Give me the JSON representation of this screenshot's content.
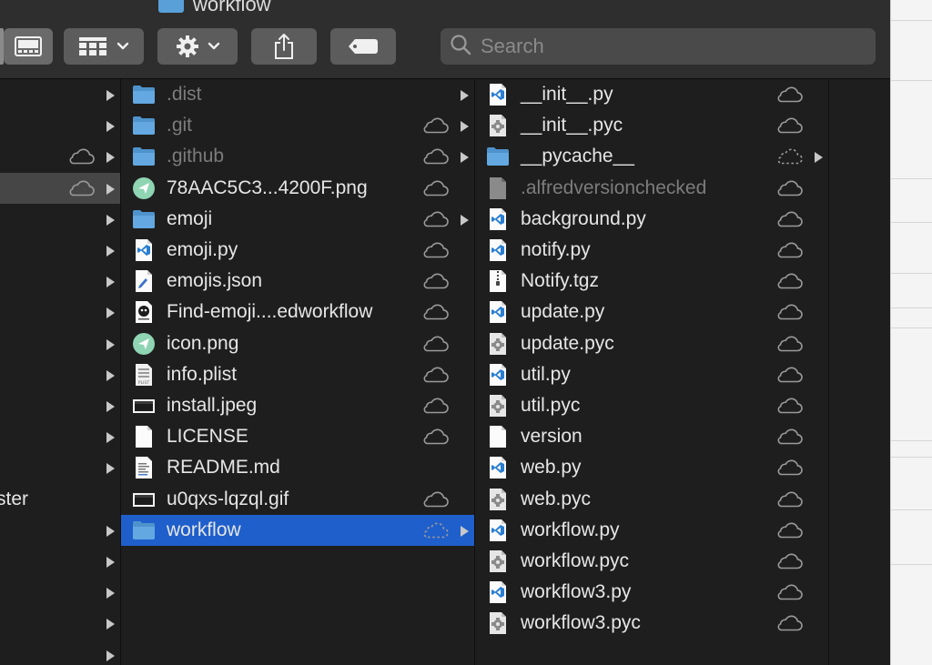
{
  "window": {
    "title": "workflow"
  },
  "toolbar": {
    "view_icon": "sidebar-icon",
    "group_icon": "grid-icon",
    "action_icon": "gear-icon",
    "share_icon": "share-icon",
    "tag_icon": "tag-icon"
  },
  "search": {
    "placeholder": "Search"
  },
  "column1": {
    "rows": [
      {
        "cloud": false,
        "arrow": true
      },
      {
        "cloud": false,
        "arrow": true
      },
      {
        "cloud": true,
        "arrow": true
      },
      {
        "cloud": true,
        "arrow": true,
        "highlighted": true
      },
      {
        "cloud": false,
        "arrow": true
      },
      {
        "cloud": false,
        "arrow": true
      },
      {
        "cloud": false,
        "arrow": true
      },
      {
        "cloud": false,
        "arrow": true
      },
      {
        "cloud": false,
        "arrow": true
      },
      {
        "cloud": false,
        "arrow": true
      },
      {
        "cloud": false,
        "arrow": true
      },
      {
        "cloud": false,
        "arrow": true
      },
      {
        "cloud": false,
        "arrow": true
      },
      {
        "label": "ster",
        "cloud": false,
        "arrow": false
      },
      {
        "cloud": false,
        "arrow": true
      },
      {
        "cloud": false,
        "arrow": true
      },
      {
        "cloud": false,
        "arrow": true
      },
      {
        "cloud": false,
        "arrow": true
      },
      {
        "cloud": false,
        "arrow": true
      }
    ]
  },
  "column2": {
    "rows": [
      {
        "name": ".dist",
        "icon": "folder",
        "dim": true,
        "cloud": "none",
        "arrow": true
      },
      {
        "name": ".git",
        "icon": "folder",
        "dim": true,
        "cloud": "solid",
        "arrow": true
      },
      {
        "name": ".github",
        "icon": "folder",
        "dim": true,
        "cloud": "solid",
        "arrow": true
      },
      {
        "name": "78AAC5C3...4200F.png",
        "icon": "image-green",
        "dim": false,
        "cloud": "solid",
        "arrow": false
      },
      {
        "name": "emoji",
        "icon": "folder",
        "dim": false,
        "cloud": "solid",
        "arrow": true
      },
      {
        "name": "emoji.py",
        "icon": "vscode",
        "dim": false,
        "cloud": "solid",
        "arrow": false
      },
      {
        "name": "emojis.json",
        "icon": "json",
        "dim": false,
        "cloud": "solid",
        "arrow": false
      },
      {
        "name": "Find-emoji....edworkflow",
        "icon": "workflow",
        "dim": false,
        "cloud": "solid",
        "arrow": false
      },
      {
        "name": "icon.png",
        "icon": "image-green",
        "dim": false,
        "cloud": "solid",
        "arrow": false
      },
      {
        "name": "info.plist",
        "icon": "plist",
        "dim": false,
        "cloud": "solid",
        "arrow": false
      },
      {
        "name": "install.jpeg",
        "icon": "jpeg",
        "dim": false,
        "cloud": "solid",
        "arrow": false
      },
      {
        "name": "LICENSE",
        "icon": "doc",
        "dim": false,
        "cloud": "solid",
        "arrow": false
      },
      {
        "name": "README.md",
        "icon": "text",
        "dim": false,
        "cloud": "none",
        "arrow": false
      },
      {
        "name": "u0qxs-lqzql.gif",
        "icon": "jpeg",
        "dim": false,
        "cloud": "solid",
        "arrow": false
      },
      {
        "name": "workflow",
        "icon": "folder",
        "dim": false,
        "cloud": "dashed",
        "arrow": true,
        "selected": true
      }
    ]
  },
  "column3": {
    "rows": [
      {
        "name": "__init__.py",
        "icon": "vscode",
        "dim": false,
        "cloud": "solid",
        "arrow": false
      },
      {
        "name": "__init__.pyc",
        "icon": "pyc",
        "dim": false,
        "cloud": "solid",
        "arrow": false
      },
      {
        "name": "__pycache__",
        "icon": "folder",
        "dim": false,
        "cloud": "dashed",
        "arrow": true
      },
      {
        "name": ".alfredversionchecked",
        "icon": "doc-grey",
        "dim": true,
        "cloud": "solid",
        "arrow": false
      },
      {
        "name": "background.py",
        "icon": "vscode",
        "dim": false,
        "cloud": "solid",
        "arrow": false
      },
      {
        "name": "notify.py",
        "icon": "vscode",
        "dim": false,
        "cloud": "solid",
        "arrow": false
      },
      {
        "name": "Notify.tgz",
        "icon": "archive",
        "dim": false,
        "cloud": "solid",
        "arrow": false
      },
      {
        "name": "update.py",
        "icon": "vscode",
        "dim": false,
        "cloud": "solid",
        "arrow": false
      },
      {
        "name": "update.pyc",
        "icon": "pyc",
        "dim": false,
        "cloud": "solid",
        "arrow": false
      },
      {
        "name": "util.py",
        "icon": "vscode",
        "dim": false,
        "cloud": "solid",
        "arrow": false
      },
      {
        "name": "util.pyc",
        "icon": "pyc",
        "dim": false,
        "cloud": "solid",
        "arrow": false
      },
      {
        "name": "version",
        "icon": "doc",
        "dim": false,
        "cloud": "solid",
        "arrow": false
      },
      {
        "name": "web.py",
        "icon": "vscode",
        "dim": false,
        "cloud": "solid",
        "arrow": false
      },
      {
        "name": "web.pyc",
        "icon": "pyc",
        "dim": false,
        "cloud": "solid",
        "arrow": false
      },
      {
        "name": "workflow.py",
        "icon": "vscode",
        "dim": false,
        "cloud": "solid",
        "arrow": false
      },
      {
        "name": "workflow.pyc",
        "icon": "pyc",
        "dim": false,
        "cloud": "solid",
        "arrow": false
      },
      {
        "name": "workflow3.py",
        "icon": "vscode",
        "dim": false,
        "cloud": "solid",
        "arrow": false
      },
      {
        "name": "workflow3.pyc",
        "icon": "pyc",
        "dim": false,
        "cloud": "solid",
        "arrow": false
      }
    ]
  },
  "colors": {
    "window_bg": "#1e1e1e",
    "selection": "#1f5fcb",
    "folder": "#5aa0d8",
    "text": "#e6e6e6",
    "dim_text": "#7c7c7c"
  }
}
